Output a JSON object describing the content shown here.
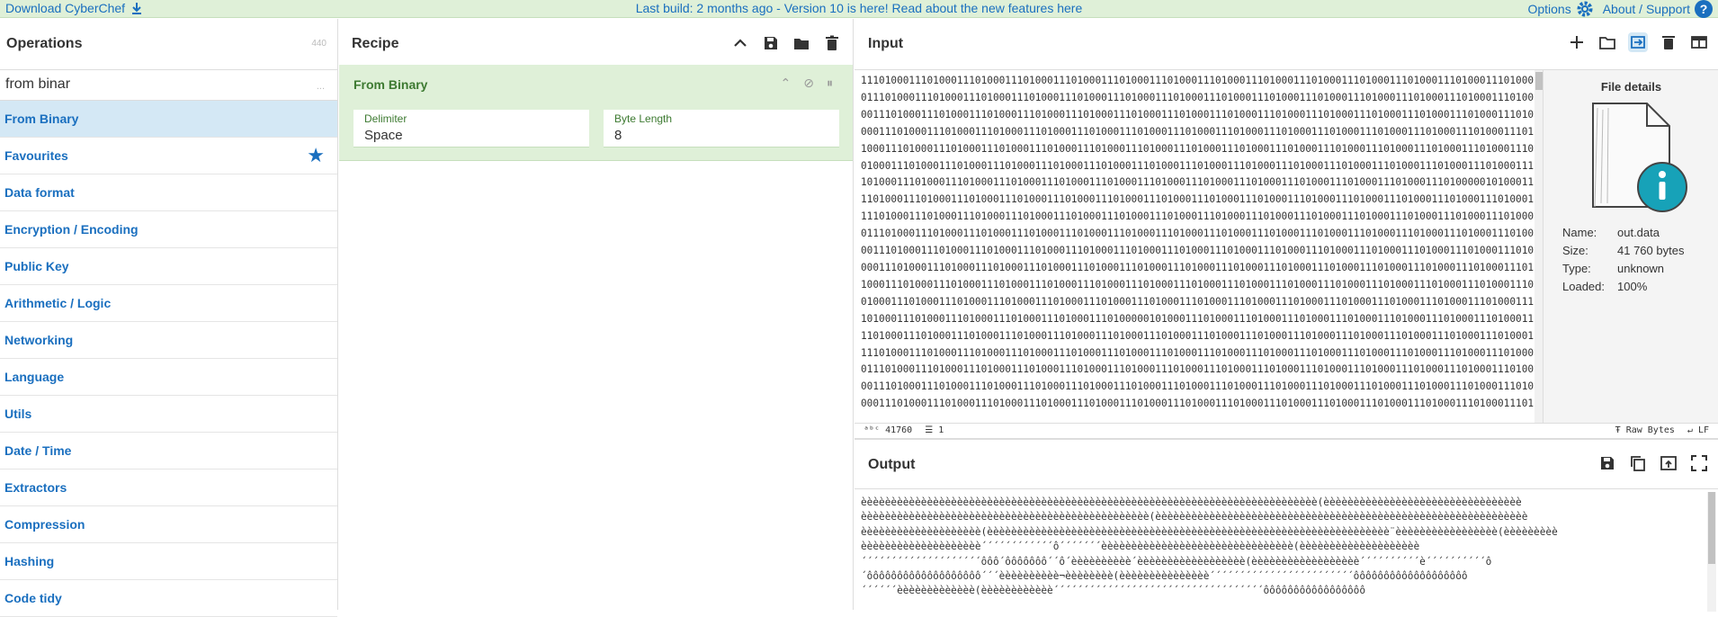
{
  "topbar": {
    "download_label": "Download CyberChef",
    "notice": "Last build: 2 months ago - Version 10 is here! Read about the new features here",
    "options_label": "Options",
    "about_label": "About / Support"
  },
  "operations": {
    "title": "Operations",
    "count": "440",
    "search_value": "from binar",
    "search_hint": "...",
    "items": [
      {
        "label": "From Binary",
        "selected": true
      },
      {
        "label": "Favourites",
        "star": true
      },
      {
        "label": "Data format"
      },
      {
        "label": "Encryption / Encoding"
      },
      {
        "label": "Public Key"
      },
      {
        "label": "Arithmetic / Logic"
      },
      {
        "label": "Networking"
      },
      {
        "label": "Language"
      },
      {
        "label": "Utils"
      },
      {
        "label": "Date / Time"
      },
      {
        "label": "Extractors"
      },
      {
        "label": "Compression"
      },
      {
        "label": "Hashing"
      },
      {
        "label": "Code tidy"
      }
    ]
  },
  "recipe": {
    "title": "Recipe",
    "operation": {
      "name": "From Binary",
      "delimiter_label": "Delimiter",
      "delimiter_value": "Space",
      "byte_length_label": "Byte Length",
      "byte_length_value": "8"
    }
  },
  "input": {
    "title": "Input",
    "lines": [
      "11101000111010001110100011101000111010001110100011101000111010001110100011101000111010001110100011101000111010001110100",
      "01110100011101000111010001110100011101000111010001110100011101000111010001110100011101000111010001110100011101000111010",
      "00111010001110100011101000111010001110100011101000111010001110100011101000111010001110100011101000111010001110100011101",
      "00011101000111010001110100011101000111010001110100011101000111010001110100011101000111010001110100011101000111010001110",
      "10001110100011101000111010001110100011101000111010001110100011101000111010001110100011101000111010001110100011101000111",
      "01000111010001110100011101000111010001110100011101000111010001110100011101000111010001110100011101000111010001110100011",
      "10100011101000111010001110100011101000111010001110100011101000111010001110100011101000111010001110100000101000111010001",
      "11010001110100011101000111010001110100011101000111010001110100011101000111010001110100011101000111010001110100011101000",
      "11101000111010001110100011101000111010001110100011101000111010001110100011101000111010001110100011101000111010001110100",
      "01110100011101000111010001110100011101000111010001110100011101000111010001110100011101000111010001110100011101000111010",
      "00111010001110100011101000111010001110100011101000111010001110100011101000111010001110100011101000111010001110100011101",
      "00011101000111010001110100011101000111010001110100011101000111010001110100011101000111010001110100011101000111010001110",
      "10001110100011101000111010001110100011101000111010001110100011101000111010001110100011101000111010001110100011101000111",
      "01000111010001110100011101000111010001110100011101000111010001110100011101000111010001110100011101000111010001110100011",
      "10100011101000111010001110100011101000111010000010100011101000111010001110100011101000111010001110100011101000111010001",
      "11010001110100011101000111010001110100011101000111010001110100011101000111010001110100011101000111010001110100011101000",
      "11101000111010001110100011101000111010001110100011101000111010001110100011101000111010001110100011101000111010001110100",
      "01110100011101000111010001110100011101000111010001110100011101000111010001110100011101000111010001110100011101000111010",
      "00111010001110100011101000111010001110100011101000111010001110100011101000111010001110100011101000111010001110100011101",
      "00011101000111010001110100011101000111010001110100011101000111010001110100011101000111010001110100011101000111010001110"
    ],
    "status": {
      "length": "41760",
      "lines": "1",
      "encoding": "Raw Bytes",
      "eol": "LF"
    },
    "file_details": {
      "title": "File details",
      "name_label": "Name:",
      "name_value": "out.data",
      "size_label": "Size:",
      "size_value": "41 760 bytes",
      "type_label": "Type:",
      "type_value": "unknown",
      "loaded_label": "Loaded:",
      "loaded_value": "100%"
    }
  },
  "output": {
    "title": "Output",
    "lines": [
      "èèèèèèèèèèèèèèèèèèèèèèèèèèèèèèèèèèèèèèèèèèèèèèèèèèèèèèèèèèèèèèèèèèèèèèèèèèèè(èèèèèèèèèèèèèèèèèèèèèèèèèèèèèèèèè",
      "èèèèèèèèèèèèèèèèèèèèèèèèèèèèèèèèèèèèèèèèèèèèèèèè(èèèèèèèèèèèèèèèèèèèèèèèèèèèèèèèèèèèèèèèèèèèèèèèèèèèèèèèèèèèèèè",
      "èèèèèèèèèèèèèèèèèèèè(èèèèèèèèèèèèèèèèèèèèèèèèèèèèèèèèèèèèèèèèèèèèèèèèèèèèèèèèèèèèèèèèèèè¨èèèèèèèèèèèèèèèèè(èèèèèèèèè",
      "èèèèèèèèèèèèèèèèèèèè´´´´´´´´´´´´ô´´´´´´´èèèèèèèèèèèèèèèèèèèèèèèèèèèèèèèè(èèèèèèèèèèèèèèèèèèèè",
      "´´´´´´´´´´´´´´´´´´´´ôôô´ôôôôôôô´´ô´èèèèèèèèèè´èèèèèèèèèèèèèèèèèè(èèèèèèèèèèèèèèèèèè´´´´´´´´´´è´´´´´´´´´´ô",
      "´ôôôôôôôôôôôôôôôôôôô´´´èèèèèèèèèè¬èèèèèèèè(èèèèèèèèèèèèèèè´´´´´´´´´´´´´´´´´´´´´´´´ôôôôôôôôôôôôôôôôôôô",
      "´´´´´´èèèèèèèèèèèèè(èèèèèèèèèèèè´´´´´´´´´´´´´´´´´´´´´´´´´´´´´´´´´´´ôôôôôôôôôôôôôôôôô"
    ]
  }
}
